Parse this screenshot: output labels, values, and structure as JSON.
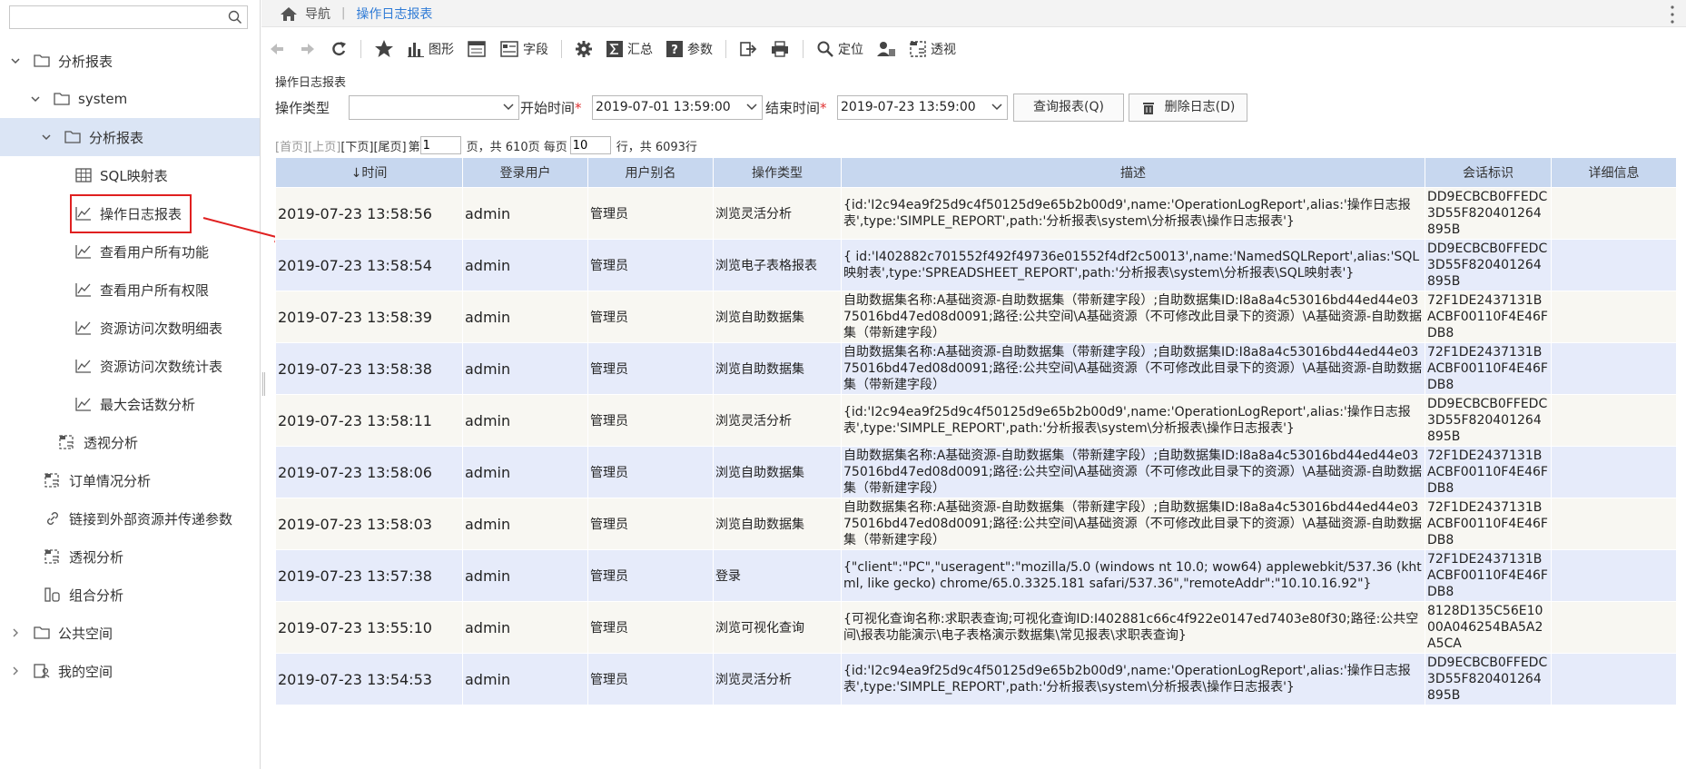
{
  "sidebar": {
    "search": {
      "placeholder": ""
    },
    "items": [
      {
        "label": "分析报表"
      },
      {
        "label": "system"
      },
      {
        "label": "分析报表"
      },
      {
        "label": "SQL映射表"
      },
      {
        "label": "操作日志报表"
      },
      {
        "label": "查看用户所有功能"
      },
      {
        "label": "查看用户所有权限"
      },
      {
        "label": "资源访问次数明细表"
      },
      {
        "label": "资源访问次数统计表"
      },
      {
        "label": "最大会话数分析"
      },
      {
        "label": "透视分析"
      },
      {
        "label": "订单情况分析"
      },
      {
        "label": "链接到外部资源并传递参数"
      },
      {
        "label": "透视分析"
      },
      {
        "label": "组合分析"
      },
      {
        "label": "公共空间"
      },
      {
        "label": "我的空间"
      }
    ]
  },
  "breadcrumb": {
    "nav": "导航",
    "separator": "|",
    "current": "操作日志报表"
  },
  "toolbar": {
    "chart": "图形",
    "fields": "字段",
    "summary": "汇总",
    "params": "参数",
    "locate": "定位",
    "pivot": "透视"
  },
  "report": {
    "name": "操作日志报表",
    "params": {
      "op_type_label": "操作类型",
      "op_type_value": "",
      "start_label": "开始时间",
      "start_value": "2019-07-01 13:59:00",
      "end_label": "结束时间",
      "end_value": "2019-07-23 13:59:00",
      "required_mark": "*",
      "query_button": "查询报表(Q)",
      "delete_button": "删除日志(D)"
    },
    "pager": {
      "first": "[首页]",
      "prev": "[上页]",
      "next": "[下页]",
      "last": "[尾页]",
      "page_prefix": "第",
      "page_value": "1",
      "page_mid": "页，共 610页 每页",
      "size_value": "10",
      "size_suffix": "行，共 6093行"
    },
    "columns": [
      "↓时间",
      "登录用户",
      "用户别名",
      "操作类型",
      "描述",
      "会话标识",
      "详细信息"
    ],
    "rows": [
      {
        "time": "2019-07-23  13:58:56",
        "user": "admin",
        "alias": "管理员",
        "op": "浏览灵活分析",
        "desc": "{id:'I2c94ea9f25d9c4f50125d9e65b2b00d9',name:'OperationLogReport',alias:'操作日志报表',type:'SIMPLE_REPORT',path:'分析报表\\system\\分析报表\\操作日志报表'}",
        "session": "DD9ECBCB0FFEDC3D55F820401264895B",
        "detail": ""
      },
      {
        "time": "2019-07-23  13:58:54",
        "user": "admin",
        "alias": "管理员",
        "op": "浏览电子表格报表",
        "desc": "{ id:'I402882c701552f492f49736e01552f4df2c50013',name:'NamedSQLReport',alias:'SQL映射表',type:'SPREADSHEET_REPORT',path:'分析报表\\system\\分析报表\\SQL映射表'}",
        "session": "DD9ECBCB0FFEDC3D55F820401264895B",
        "detail": ""
      },
      {
        "time": "2019-07-23  13:58:39",
        "user": "admin",
        "alias": "管理员",
        "op": "浏览自助数据集",
        "desc": "自助数据集名称:A基础资源-自助数据集（带新建字段）;自助数据集ID:I8a8a4c53016bd44ed44e0375016bd47ed08d0091;路径:公共空间\\A基础资源（不可修改此目录下的资源）\\A基础资源-自助数据集（带新建字段）",
        "session": "72F1DE2437131BACBF00110F4E46FDB8",
        "detail": ""
      },
      {
        "time": "2019-07-23  13:58:38",
        "user": "admin",
        "alias": "管理员",
        "op": "浏览自助数据集",
        "desc": "自助数据集名称:A基础资源-自助数据集（带新建字段）;自助数据集ID:I8a8a4c53016bd44ed44e0375016bd47ed08d0091;路径:公共空间\\A基础资源（不可修改此目录下的资源）\\A基础资源-自助数据集（带新建字段）",
        "session": "72F1DE2437131BACBF00110F4E46FDB8",
        "detail": ""
      },
      {
        "time": "2019-07-23  13:58:11",
        "user": "admin",
        "alias": "管理员",
        "op": "浏览灵活分析",
        "desc": "{id:'I2c94ea9f25d9c4f50125d9e65b2b00d9',name:'OperationLogReport',alias:'操作日志报表',type:'SIMPLE_REPORT',path:'分析报表\\system\\分析报表\\操作日志报表'}",
        "session": "DD9ECBCB0FFEDC3D55F820401264895B",
        "detail": ""
      },
      {
        "time": "2019-07-23  13:58:06",
        "user": "admin",
        "alias": "管理员",
        "op": "浏览自助数据集",
        "desc": "自助数据集名称:A基础资源-自助数据集（带新建字段）;自助数据集ID:I8a8a4c53016bd44ed44e0375016bd47ed08d0091;路径:公共空间\\A基础资源（不可修改此目录下的资源）\\A基础资源-自助数据集（带新建字段）",
        "session": "72F1DE2437131BACBF00110F4E46FDB8",
        "detail": ""
      },
      {
        "time": "2019-07-23  13:58:03",
        "user": "admin",
        "alias": "管理员",
        "op": "浏览自助数据集",
        "desc": "自助数据集名称:A基础资源-自助数据集（带新建字段）;自助数据集ID:I8a8a4c53016bd44ed44e0375016bd47ed08d0091;路径:公共空间\\A基础资源（不可修改此目录下的资源）\\A基础资源-自助数据集（带新建字段）",
        "session": "72F1DE2437131BACBF00110F4E46FDB8",
        "detail": ""
      },
      {
        "time": "2019-07-23  13:57:38",
        "user": "admin",
        "alias": "管理员",
        "op": "登录",
        "desc": "{\"client\":\"PC\",\"useragent\":\"mozilla/5.0 (windows nt 10.0; wow64) applewebkit/537.36 (khtml, like gecko) chrome/65.0.3325.181 safari/537.36\",\"remoteAddr\":\"10.10.16.92\"}",
        "session": "72F1DE2437131BACBF00110F4E46FDB8",
        "detail": ""
      },
      {
        "time": "2019-07-23  13:55:10",
        "user": "admin",
        "alias": "管理员",
        "op": "浏览可视化查询",
        "desc": "{可视化查询名称:求职表查询;可视化查询ID:I402881c66c4f922e0147ed7403e80f30;路径:公共空间\\报表功能演示\\电子表格演示数据集\\常见报表\\求职表查询}",
        "session": "8128D135C56E1000A046254BA5A2A5CA",
        "detail": ""
      },
      {
        "time": "2019-07-23  13:54:53",
        "user": "admin",
        "alias": "管理员",
        "op": "浏览灵活分析",
        "desc": "{id:'I2c94ea9f25d9c4f50125d9e65b2b00d9',name:'OperationLogReport',alias:'操作日志报表',type:'SIMPLE_REPORT',path:'分析报表\\system\\分析报表\\操作日志报表'}",
        "session": "DD9ECBCB0FFEDC3D55F820401264895B",
        "detail": ""
      }
    ]
  },
  "colors": {
    "accent": "#2f7bd6",
    "header_bg": "#c7d7ef",
    "row_odd": "#f8f7f2",
    "row_even": "#e6ebfa",
    "highlight": "#e02020",
    "selected": "#dbe5f5"
  },
  "icons": [
    "search-icon",
    "folder-icon",
    "table-icon",
    "chart-icon",
    "pivot-icon",
    "link-icon",
    "combo-icon",
    "space-icon",
    "home-icon",
    "back-icon",
    "forward-icon",
    "refresh-icon",
    "star-icon",
    "field-icon",
    "gear-icon",
    "sum-icon",
    "help-icon",
    "export-icon",
    "print-icon",
    "locate-icon",
    "user-icon",
    "pivot-icon",
    "trash-icon",
    "more-icon"
  ]
}
